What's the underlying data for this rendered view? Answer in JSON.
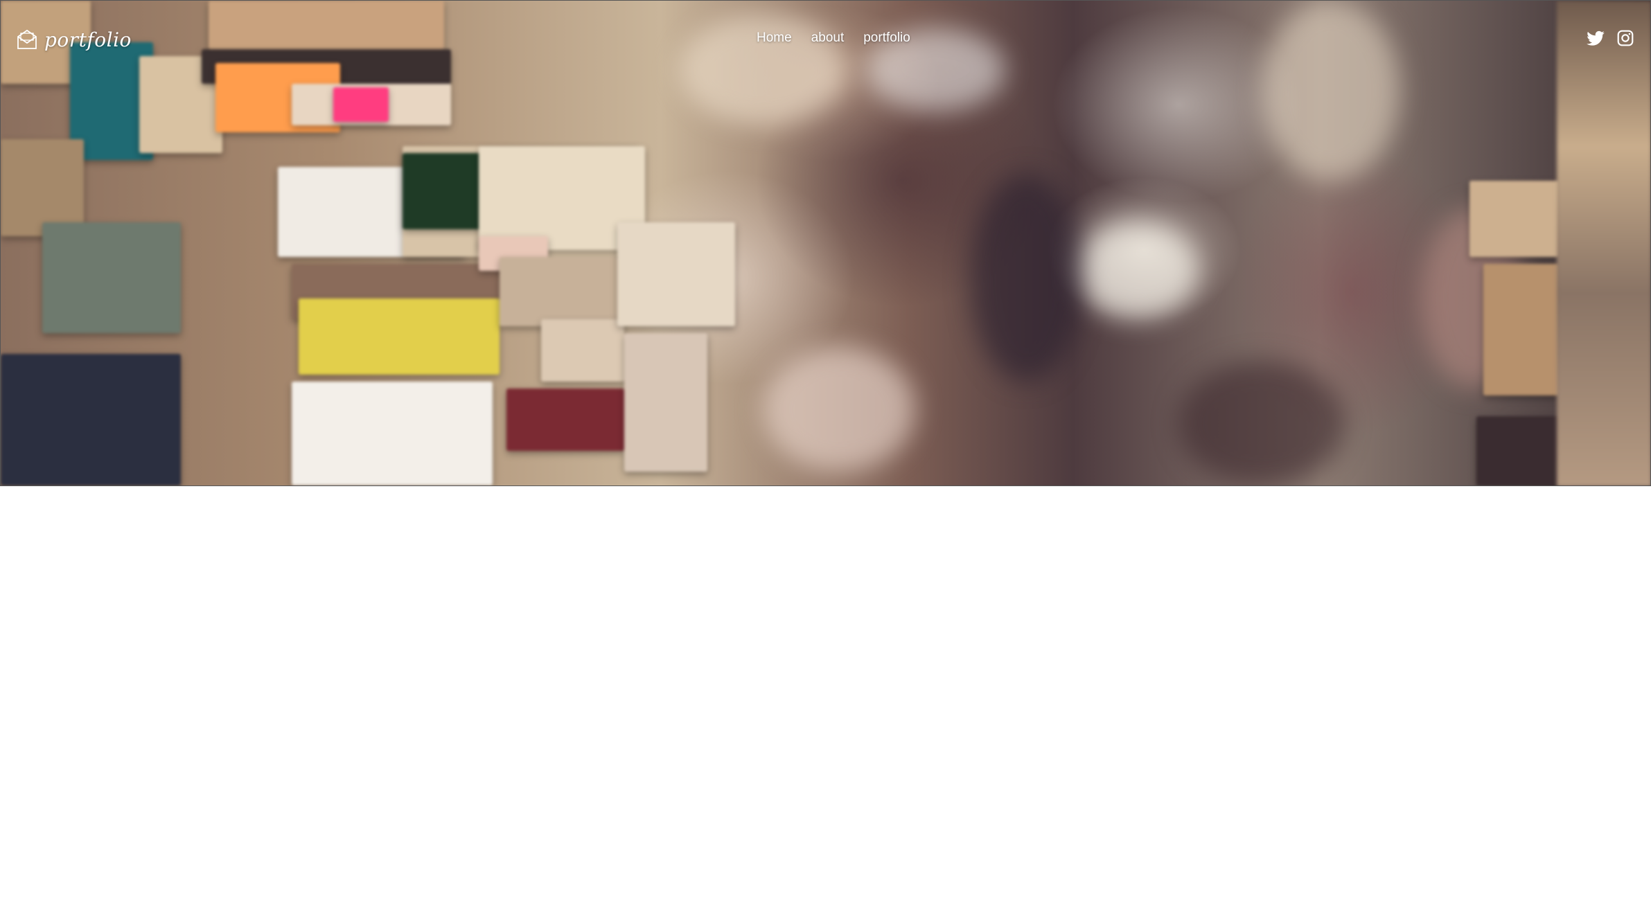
{
  "header": {
    "logo_text": "portfolio",
    "nav": [
      {
        "label": "Home"
      },
      {
        "label": "about"
      },
      {
        "label": "portfolio"
      }
    ],
    "social": [
      {
        "icon": "twitter-icon"
      },
      {
        "icon": "instagram-icon"
      }
    ]
  },
  "colors": {
    "nav_text": "#ffffff",
    "page_background": "#ffffff"
  }
}
